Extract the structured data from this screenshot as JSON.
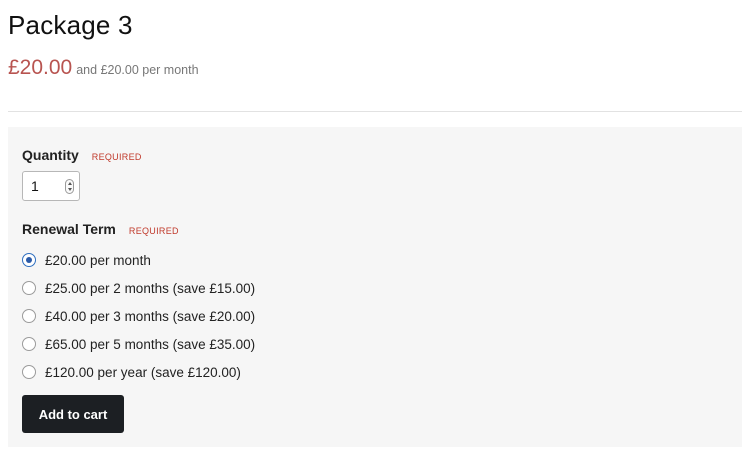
{
  "product": {
    "title": "Package 3",
    "price": "£20.00",
    "price_note": "and £20.00 per month",
    "accent_color": "#b85450"
  },
  "quantity": {
    "label": "Quantity",
    "required": "REQUIRED",
    "value": "1"
  },
  "renewal": {
    "label": "Renewal Term",
    "required": "REQUIRED",
    "options": [
      {
        "label": "£20.00 per month",
        "selected": true
      },
      {
        "label": "£25.00 per 2 months (save £15.00)",
        "selected": false
      },
      {
        "label": "£40.00 per 3 months (save £20.00)",
        "selected": false
      },
      {
        "label": "£65.00 per 5 months (save £35.00)",
        "selected": false
      },
      {
        "label": "£120.00 per year (save £120.00)",
        "selected": false
      }
    ]
  },
  "actions": {
    "add_to_cart": "Add to cart"
  }
}
